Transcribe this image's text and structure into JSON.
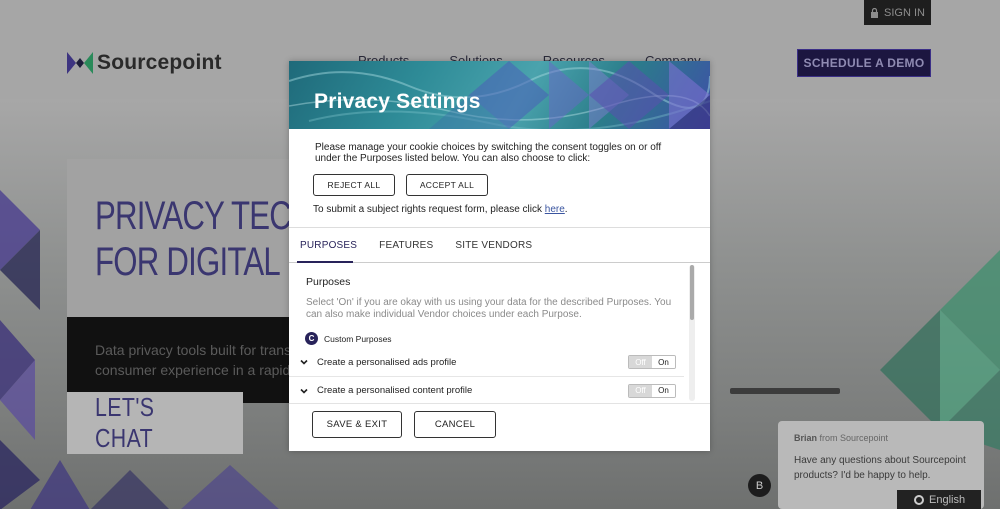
{
  "site": {
    "signin_label": "SIGN IN",
    "logo_text": "Sourcepoint",
    "nav_items": [
      "Products",
      "Solutions",
      "Resources",
      "Company"
    ],
    "demo_label": "SCHEDULE A DEMO",
    "hero_title": "PRIVACY TECH\nFOR DIGITAL M",
    "hero_sub": "Data privacy tools built for transpa\nconsumer experience in a rapidly c",
    "chat_cta": "LET'S CHAT",
    "colors": {
      "brand_purple": "#28235a",
      "demo_bg": "#1c1640"
    }
  },
  "modal": {
    "title": "Privacy Settings",
    "intro": "Please manage your cookie choices by switching the consent toggles on or off under the Purposes listed below. You can also choose to click:",
    "reject_label": "REJECT ALL",
    "accept_label": "ACCEPT ALL",
    "rights_text": "To submit a subject rights request form, please click ",
    "rights_link": "here",
    "rights_suffix": ".",
    "tabs": [
      {
        "label": "PURPOSES",
        "active": true
      },
      {
        "label": "FEATURES",
        "active": false
      },
      {
        "label": "SITE VENDORS",
        "active": false
      }
    ],
    "purposes": {
      "heading": "Purposes",
      "description": "Select 'On' if you are okay with us using your data for the described Purposes. You can also make individual Vendor choices under each Purpose.",
      "custom_icon": "C",
      "custom_label": "Custom Purposes",
      "items": [
        {
          "label": "Create a personalised ads profile",
          "off": "Off",
          "on": "On",
          "state": "off"
        },
        {
          "label": "Create a personalised content profile",
          "off": "Off",
          "on": "On",
          "state": "off"
        }
      ]
    },
    "save_label": "SAVE & EXIT",
    "cancel_label": "CANCEL"
  },
  "chat": {
    "sender_name": "Brian",
    "sender_from": " from Sourcepoint",
    "message": "Have any questions about Sourcepoint products? I'd be happy to help.",
    "avatar_letter": "B",
    "language": "English"
  }
}
